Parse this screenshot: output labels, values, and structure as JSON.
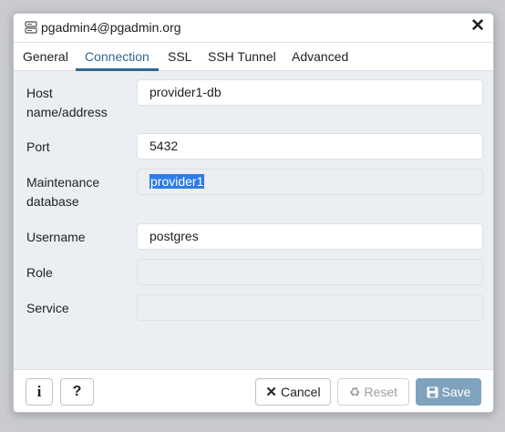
{
  "dialog": {
    "title": "pgadmin4@pgadmin.org",
    "close_glyph": "✕",
    "icon": "server-icon"
  },
  "tabs": [
    {
      "label": "General"
    },
    {
      "label": "Connection",
      "active": true
    },
    {
      "label": "SSL"
    },
    {
      "label": "SSH Tunnel"
    },
    {
      "label": "Advanced"
    }
  ],
  "form": {
    "host_label_1": "Host",
    "host_label_2": "name/address",
    "host_value": "provider1-db",
    "port_label": "Port",
    "port_value": "5432",
    "maint_label_1": "Maintenance",
    "maint_label_2": "database",
    "maint_value": "provider1",
    "username_label": "Username",
    "username_value": "postgres",
    "role_label": "Role",
    "role_value": "",
    "service_label": "Service",
    "service_value": ""
  },
  "footer": {
    "info_glyph": "i",
    "help_glyph": "?",
    "cancel_label": "Cancel",
    "reset_label": "Reset",
    "save_label": "Save"
  },
  "colors": {
    "accent": "#326690",
    "selection": "#2f7ce6",
    "save_button": "#7fa3be"
  }
}
